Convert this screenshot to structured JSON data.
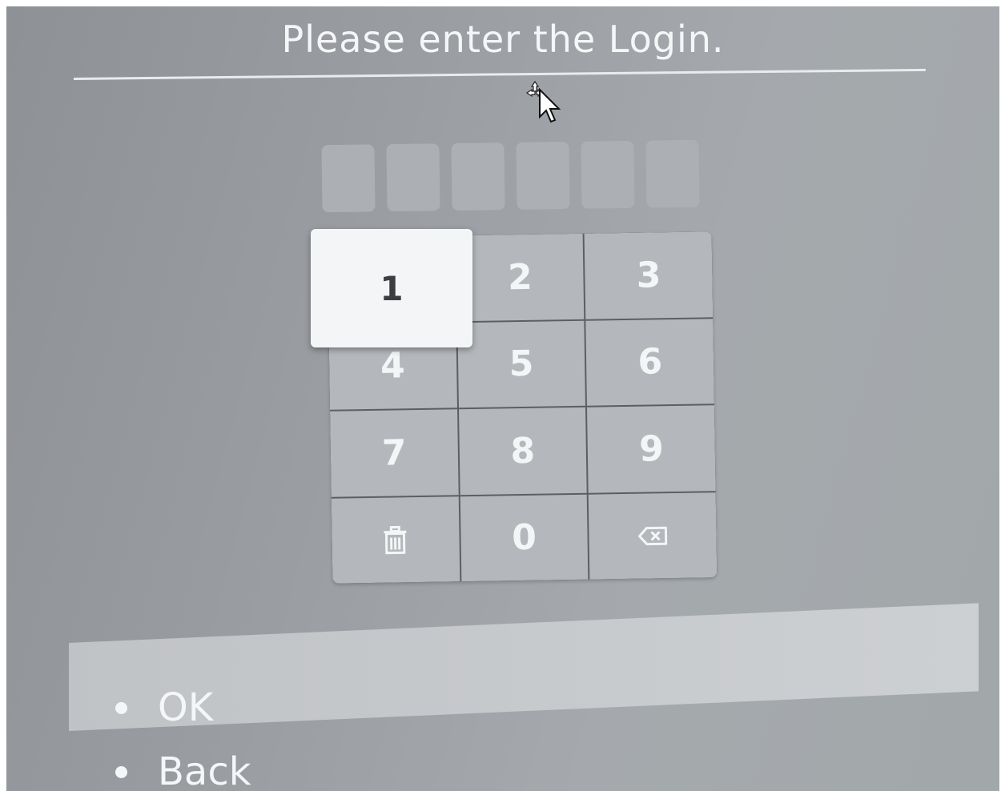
{
  "dialog": {
    "title": "Please enter the Login."
  },
  "pin": {
    "length": 6,
    "entered": 0
  },
  "keypad": {
    "focused_key": "1",
    "keys": [
      "1",
      "2",
      "3",
      "4",
      "5",
      "6",
      "7",
      "8",
      "9",
      "trash-icon",
      "0",
      "backspace-icon"
    ]
  },
  "menu": {
    "items": [
      {
        "label": "OK",
        "selected": true
      },
      {
        "label": "Back",
        "selected": false
      }
    ]
  }
}
